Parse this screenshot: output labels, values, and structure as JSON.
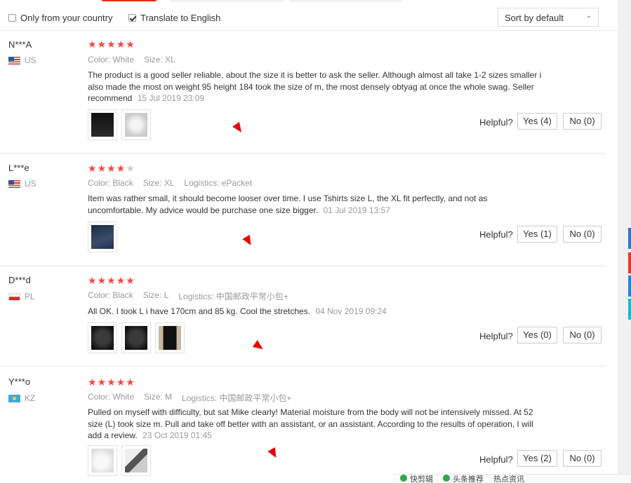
{
  "filters": {
    "only_country_label": "Only from your country",
    "only_country_checked": false,
    "translate_label": "Translate to English",
    "translate_checked": true,
    "sort_value": "Sort by default"
  },
  "helpful_label": "Helpful?",
  "reviews": [
    {
      "user": "N***A",
      "country": "US",
      "rating": 5,
      "attrs": [
        "Color: White",
        "Size: XL"
      ],
      "text": "The product is a good seller reliable, about the size it is better to ask the seller. Although almost all take 1-2 sizes smaller i also made the most on weight 95 height 184 took the size of m, the most densely obtyag at once the whole swag. Seller recommend",
      "date": "15 Jul 2019 23:09",
      "yes": "Yes (4)",
      "no": "No (0)"
    },
    {
      "user": "L***e",
      "country": "US",
      "rating": 4,
      "attrs": [
        "Color: Black",
        "Size: XL",
        "Logistics: ePacket"
      ],
      "text": "Item was rather small, it should become looser over time. I use Tshirts size L, the XL fit perfectly, and not as uncomfortable. My advice would be purchase one size bigger.",
      "date": "01 Jul 2019 13:57",
      "yes": "Yes (1)",
      "no": "No (0)"
    },
    {
      "user": "D***d",
      "country": "PL",
      "rating": 5,
      "attrs": [
        "Color: Black",
        "Size: L",
        "Logistics: 中国邮政平常小包+"
      ],
      "text": "All OK. I took L i have 170cm and 85 kg. Cool the stretches.",
      "date": "04 Nov 2019 09:24",
      "yes": "Yes (0)",
      "no": "No (0)"
    },
    {
      "user": "Y***o",
      "country": "KZ",
      "rating": 5,
      "attrs": [
        "Color: White",
        "Size: M",
        "Logistics: 中国邮政平常小包+"
      ],
      "text": "Pulled on myself with difficulty, but sat Mike clearly! Material moisture from the body will not be intensively missed. At 52 size (L) took size m. Pull and take off better with an assistant, or an assistant. According to the results of operation, I will add a review.",
      "date": "23 Oct 2019 01:45",
      "yes": "Yes (2)",
      "no": "No (0)"
    }
  ],
  "bottom_bar": [
    "快剪辑",
    "头条推荐",
    "热点资讯"
  ],
  "colors": {
    "accent": "#e62e04",
    "star": "#ff4444",
    "cursor": "#ee0000"
  }
}
